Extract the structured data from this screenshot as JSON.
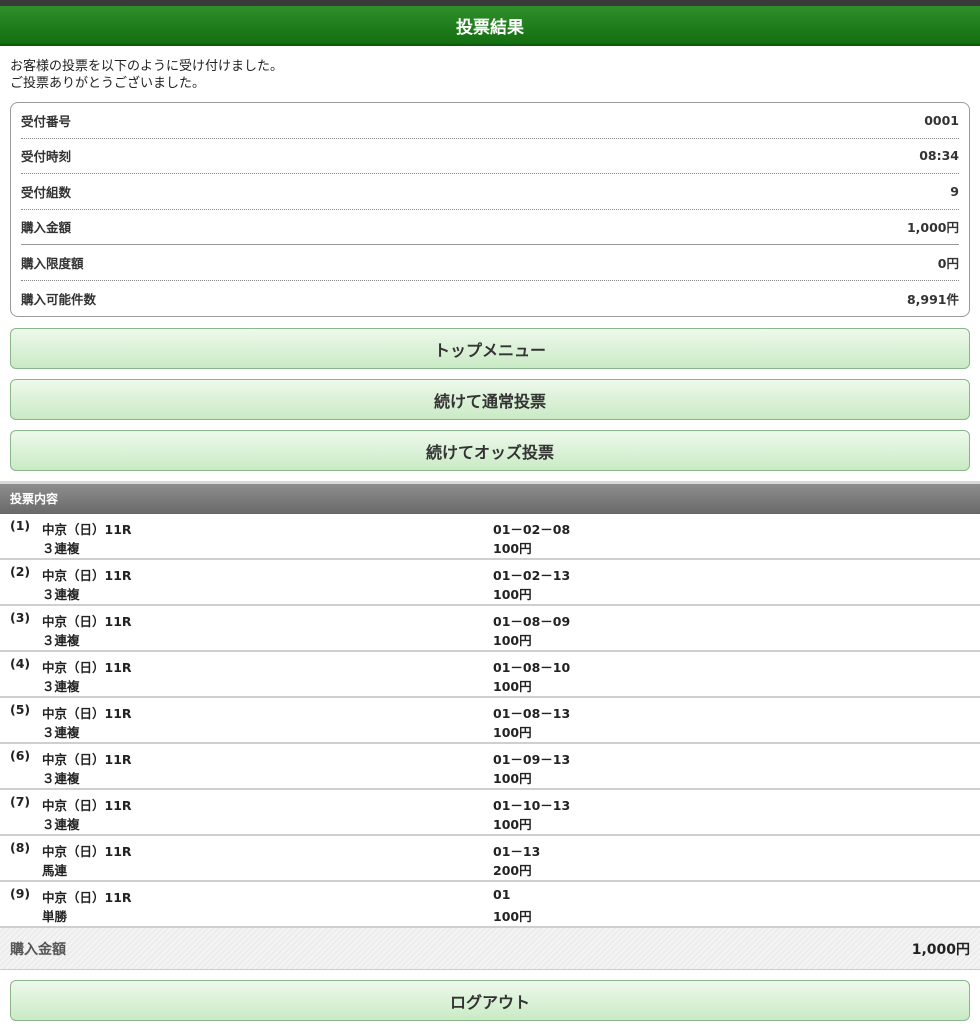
{
  "header": {
    "title": "投票結果"
  },
  "intro": {
    "line1": "お客様の投票を以下のように受け付けました。",
    "line2": "ご投票ありがとうございました。"
  },
  "info": [
    {
      "label": "受付番号",
      "value": "0001"
    },
    {
      "label": "受付時刻",
      "value": "08:34"
    },
    {
      "label": "受付組数",
      "value": "9"
    },
    {
      "label": "購入金額",
      "value": "1,000円"
    },
    {
      "label": "購入限度額",
      "value": "0円"
    },
    {
      "label": "購入可能件数",
      "value": "8,991件"
    }
  ],
  "buttons": {
    "top_menu": "トップメニュー",
    "continue_normal": "続けて通常投票",
    "continue_odds": "続けてオッズ投票",
    "logout": "ログアウト"
  },
  "section": {
    "title": "投票内容"
  },
  "bets": [
    {
      "num": "(1)",
      "race": "中京（日）11R",
      "type": "３連複",
      "combo": "01－02－08",
      "amount": "100円"
    },
    {
      "num": "(2)",
      "race": "中京（日）11R",
      "type": "３連複",
      "combo": "01－02－13",
      "amount": "100円"
    },
    {
      "num": "(3)",
      "race": "中京（日）11R",
      "type": "３連複",
      "combo": "01－08－09",
      "amount": "100円"
    },
    {
      "num": "(4)",
      "race": "中京（日）11R",
      "type": "３連複",
      "combo": "01－08－10",
      "amount": "100円"
    },
    {
      "num": "(5)",
      "race": "中京（日）11R",
      "type": "３連複",
      "combo": "01－08－13",
      "amount": "100円"
    },
    {
      "num": "(6)",
      "race": "中京（日）11R",
      "type": "３連複",
      "combo": "01－09－13",
      "amount": "100円"
    },
    {
      "num": "(7)",
      "race": "中京（日）11R",
      "type": "３連複",
      "combo": "01－10－13",
      "amount": "100円"
    },
    {
      "num": "(8)",
      "race": "中京（日）11R",
      "type": "馬連",
      "combo": "01－13",
      "amount": "200円"
    },
    {
      "num": "(9)",
      "race": "中京（日）11R",
      "type": "単勝",
      "combo": "01",
      "amount": "100円"
    }
  ],
  "total": {
    "label": "購入金額",
    "value": "1,000円"
  }
}
